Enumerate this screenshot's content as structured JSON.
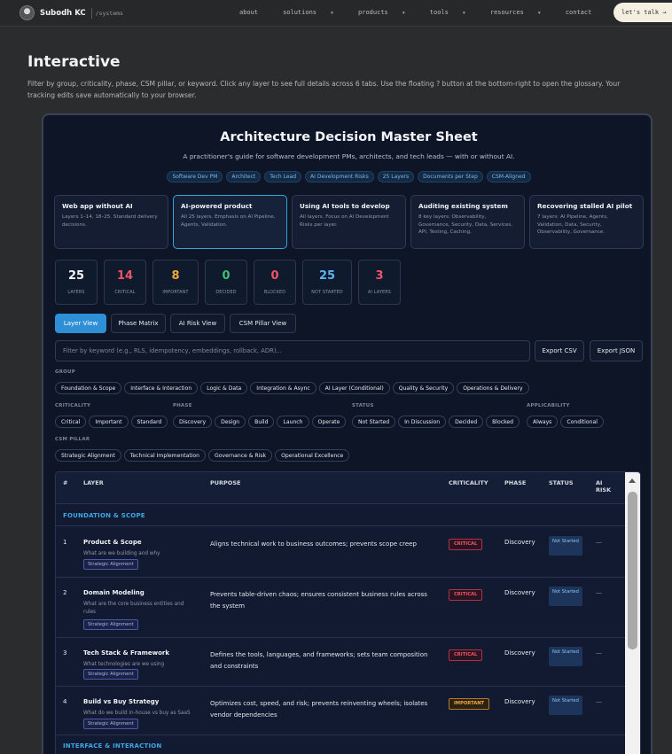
{
  "nav": {
    "brand_name": "Subodh KC",
    "brand_path": "/systems",
    "links": [
      {
        "label": "about",
        "caret": false
      },
      {
        "label": "solutions",
        "caret": true
      },
      {
        "label": "products",
        "caret": true
      },
      {
        "label": "tools",
        "caret": true
      },
      {
        "label": "resources",
        "caret": true
      },
      {
        "label": "contact",
        "caret": false
      }
    ],
    "cta": "let's talk →"
  },
  "hero": {
    "title": "Interactive",
    "description": "Filter by group, criticality, phase, CSM pillar, or keyword. Click any layer to see full details across 6 tabs. Use the floating ? button at the bottom-right to open the glossary. Your tracking edits save automatically to your browser."
  },
  "sheet": {
    "title": "Architecture Decision Master Sheet",
    "subtitle": "A practitioner's guide for software development PMs, architects, and tech leads — with or without AI.",
    "tags": [
      "Software Dev PM",
      "Architect",
      "Tech Lead",
      "AI Development Risks",
      "25 Layers",
      "Documents per Step",
      "CSM-Aligned"
    ],
    "scenarios": [
      {
        "title": "Web app without AI",
        "desc": "Layers 1–14, 18–25. Standard delivery decisions.",
        "active": false
      },
      {
        "title": "AI-powered product",
        "desc": "All 25 layers. Emphasis on AI Pipeline, Agents, Validation.",
        "active": true
      },
      {
        "title": "Using AI tools to develop",
        "desc": "All layers. Focus on AI Development Risks per layer.",
        "active": false
      },
      {
        "title": "Auditing existing system",
        "desc": "8 key layers: Observability, Governance, Security, Data, Services, API, Testing, Caching.",
        "active": false
      },
      {
        "title": "Recovering stalled AI pilot",
        "desc": "7 layers: AI Pipeline, Agents, Validation, Data, Security, Observability, Governance.",
        "active": false
      }
    ],
    "stats": [
      {
        "value": "25",
        "label": "LAYERS",
        "color": "#f2f4f8"
      },
      {
        "value": "14",
        "label": "CRITICAL",
        "color": "#ef5466"
      },
      {
        "value": "8",
        "label": "IMPORTANT",
        "color": "#f2a93b"
      },
      {
        "value": "0",
        "label": "DECIDED",
        "color": "#3fbf78"
      },
      {
        "value": "0",
        "label": "BLOCKED",
        "color": "#ef5466"
      },
      {
        "value": "25",
        "label": "NOT STARTED",
        "color": "#5bb4ef"
      },
      {
        "value": "3",
        "label": "AI LAYERS",
        "color": "#ef5466"
      }
    ],
    "view_tabs": [
      {
        "label": "Layer View",
        "active": true
      },
      {
        "label": "Phase Matrix",
        "active": false
      },
      {
        "label": "AI Risk View",
        "active": false
      },
      {
        "label": "CSM Pillar View",
        "active": false
      }
    ],
    "search_placeholder": "Filter by keyword (e.g., RLS, idempotency, embeddings, rollback, ADR)...",
    "export_csv": "Export CSV",
    "export_json": "Export JSON",
    "filters": {
      "group_label": "GROUP",
      "group": [
        "Foundation & Scope",
        "Interface & Interaction",
        "Logic & Data",
        "Integration & Async",
        "AI Layer (Conditional)",
        "Quality & Security",
        "Operations & Delivery"
      ],
      "criticality_label": "CRITICALITY",
      "criticality": [
        "Critical",
        "Important",
        "Standard"
      ],
      "phase_label": "PHASE",
      "phase": [
        "Discovery",
        "Design",
        "Build",
        "Launch",
        "Operate"
      ],
      "status_label": "STATUS",
      "status": [
        "Not Started",
        "In Discussion",
        "Decided",
        "Blocked"
      ],
      "applicability_label": "APPLICABILITY",
      "applicability": [
        "Always",
        "Conditional"
      ],
      "csm_label": "CSM PILLAR",
      "csm": [
        "Strategic Alignment",
        "Technical Implementation",
        "Governance & Risk",
        "Operational Excellence"
      ]
    },
    "table": {
      "headers": {
        "num": "#",
        "layer": "LAYER",
        "purpose": "PURPOSE",
        "criticality": "CRITICALITY",
        "phase": "PHASE",
        "status": "STATUS",
        "ai_risk_1": "AI",
        "ai_risk_2": "RISK"
      },
      "group_1": "FOUNDATION & SCOPE",
      "group_2": "INTERFACE & INTERACTION",
      "rows": [
        {
          "num": "1",
          "name": "Product & Scope",
          "question": "What are we building and why",
          "pillar": "Strategic Alignment",
          "purpose": "Aligns technical work to business outcomes; prevents scope creep",
          "criticality": "CRITICAL",
          "phase": "Discovery",
          "status": "Not Started",
          "ai": "—"
        },
        {
          "num": "2",
          "name": "Domain Modeling",
          "question": "What are the core business entities and rules",
          "pillar": "Strategic Alignment",
          "purpose": "Prevents table-driven chaos; ensures consistent business rules across the system",
          "criticality": "CRITICAL",
          "phase": "Discovery",
          "status": "Not Started",
          "ai": "—"
        },
        {
          "num": "3",
          "name": "Tech Stack & Framework",
          "question": "What technologies are we using",
          "pillar": "Strategic Alignment",
          "purpose": "Defines the tools, languages, and frameworks; sets team composition and constraints",
          "criticality": "CRITICAL",
          "phase": "Discovery",
          "status": "Not Started",
          "ai": "—"
        },
        {
          "num": "4",
          "name": "Build vs Buy Strategy",
          "question": "What do we build in-house vs buy as SaaS",
          "pillar": "Strategic Alignment",
          "purpose": "Optimizes cost, speed, and risk; prevents reinventing wheels; isolates vendor dependencies",
          "criticality": "IMPORTANT",
          "phase": "Discovery",
          "status": "Not Started",
          "ai": "—"
        }
      ]
    }
  }
}
